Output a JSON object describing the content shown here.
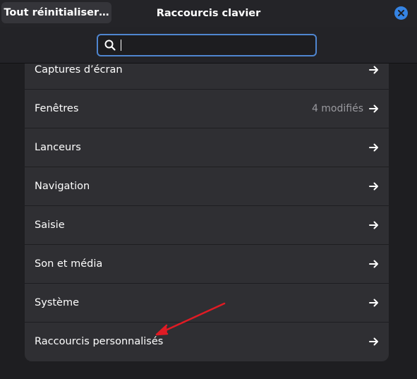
{
  "header": {
    "reset_button": "Tout réinitialiser…",
    "title": "Raccourcis clavier",
    "close_icon": "close-icon"
  },
  "search": {
    "value": "",
    "placeholder": "",
    "icon": "search-icon"
  },
  "colors": {
    "accent": "#3584e4",
    "annotation_arrow": "#e01b24"
  },
  "list": {
    "items": [
      {
        "label": "Captures d’écran",
        "value": ""
      },
      {
        "label": "Fenêtres",
        "value": "4 modifiés"
      },
      {
        "label": "Lanceurs",
        "value": ""
      },
      {
        "label": "Navigation",
        "value": ""
      },
      {
        "label": "Saisie",
        "value": ""
      },
      {
        "label": "Son et média",
        "value": ""
      },
      {
        "label": "Système",
        "value": ""
      },
      {
        "label": "Raccourcis personnalisés",
        "value": ""
      }
    ],
    "row_icon": "arrow-right-icon"
  }
}
